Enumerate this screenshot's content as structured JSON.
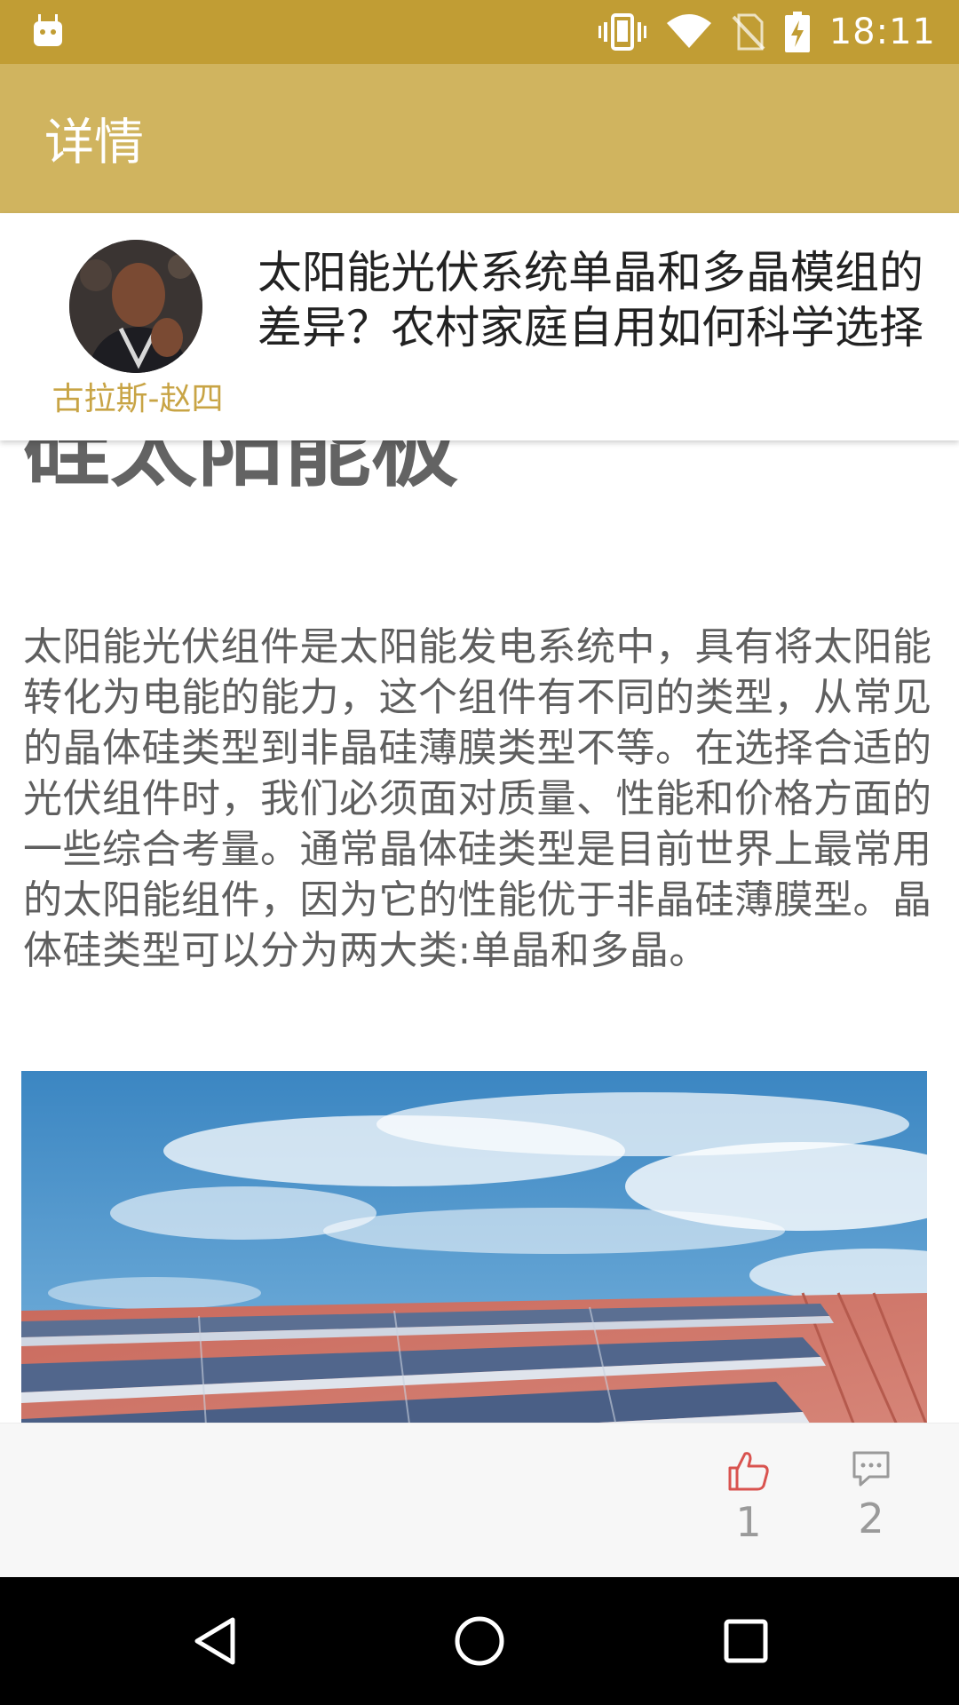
{
  "status_bar": {
    "time": "18:11",
    "left_icon": "android-debug-icon",
    "icons": [
      "vibrate-icon",
      "wifi-icon",
      "no-sim-icon",
      "battery-charging-icon"
    ]
  },
  "app_bar": {
    "title": "详情"
  },
  "post": {
    "author": "古拉斯-赵四",
    "title": "太阳能光伏系统单晶和多晶模组的差异？农村家庭自用如何科学选择"
  },
  "article": {
    "heading_visible": "硅太阳能板",
    "paragraph": "太阳能光伏组件是太阳能发电系统中，具有将太阳能转化为电能的能力，这个组件有不同的类型，从常见的晶体硅类型到非晶硅薄膜类型不等。在选择合适的光伏组件时，我们必须面对质量、性能和价格方面的一些综合考量。通常晶体硅类型是目前世界上最常用的太阳能组件，因为它的性能优于非晶硅薄膜型。晶体硅类型可以分为两大类:单晶和多晶。"
  },
  "actions": {
    "like_icon": "thumbs-up-icon",
    "like_count": "1",
    "comment_icon": "comment-icon",
    "comment_count": "2"
  },
  "nav_bar": {
    "icons": [
      "back-icon",
      "home-icon",
      "recents-icon"
    ]
  },
  "colors": {
    "status_bar": "#c19d34",
    "app_bar": "#d0b45f",
    "author_accent": "#c8a445",
    "like_icon": "#d9534f",
    "comment_icon": "#9a9a9a"
  }
}
